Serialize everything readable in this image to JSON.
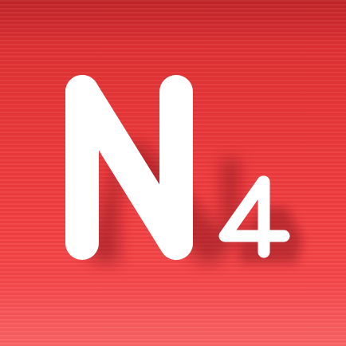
{
  "icon": {
    "letter": "N",
    "digit": "4",
    "background_color_top": "#d92e31",
    "background_color_bottom": "#f9585a",
    "glyph_color": "#ffffff"
  }
}
